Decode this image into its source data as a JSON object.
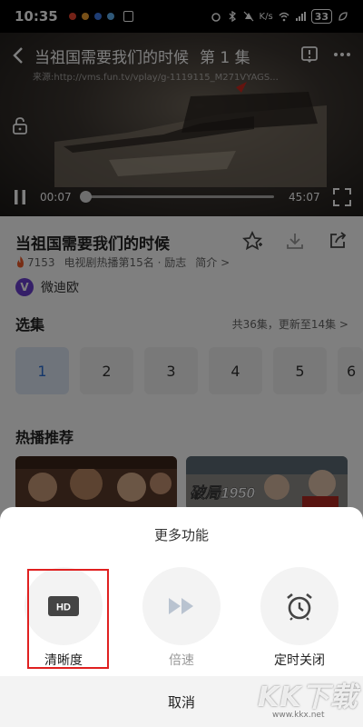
{
  "status_bar": {
    "time": "10:35",
    "net_speed": "K/s",
    "battery": "33"
  },
  "player": {
    "title": "当祖国需要我们的时候",
    "episode": "第 1 集",
    "source": "来源:http://vms.fun.tv/vplay/g-1119115_M271VYAGS...",
    "current_time": "00:07",
    "total_time": "45:07",
    "progress": 0.003
  },
  "info": {
    "title": "当祖国需要我们的时候",
    "heat": "7153",
    "meta": "电视剧热播第15名 · 励志",
    "intro_link": "简介 >",
    "publisher": "微迪欧",
    "publisher_logo": "V"
  },
  "episodes": {
    "section_title": "选集",
    "summary": "共36集，更新至14集 >",
    "items": [
      "1",
      "2",
      "3",
      "4",
      "5",
      "6"
    ],
    "selected": "1"
  },
  "recommend": {
    "section_title": "热播推荐",
    "poster_text": "破局1950"
  },
  "sheet": {
    "title": "更多功能",
    "functions": [
      {
        "label": "清晰度",
        "icon": "hd-icon"
      },
      {
        "label": "倍速",
        "icon": "fast-forward-icon"
      },
      {
        "label": "定时关闭",
        "icon": "alarm-clock-icon"
      }
    ],
    "cancel": "取消"
  },
  "watermark": {
    "logo": "KK下载",
    "url": "www.kkx.net"
  },
  "colors": {
    "accent_blue": "#2b6fd6",
    "highlight_red": "#e02020",
    "fire_orange": "#f05a28"
  }
}
